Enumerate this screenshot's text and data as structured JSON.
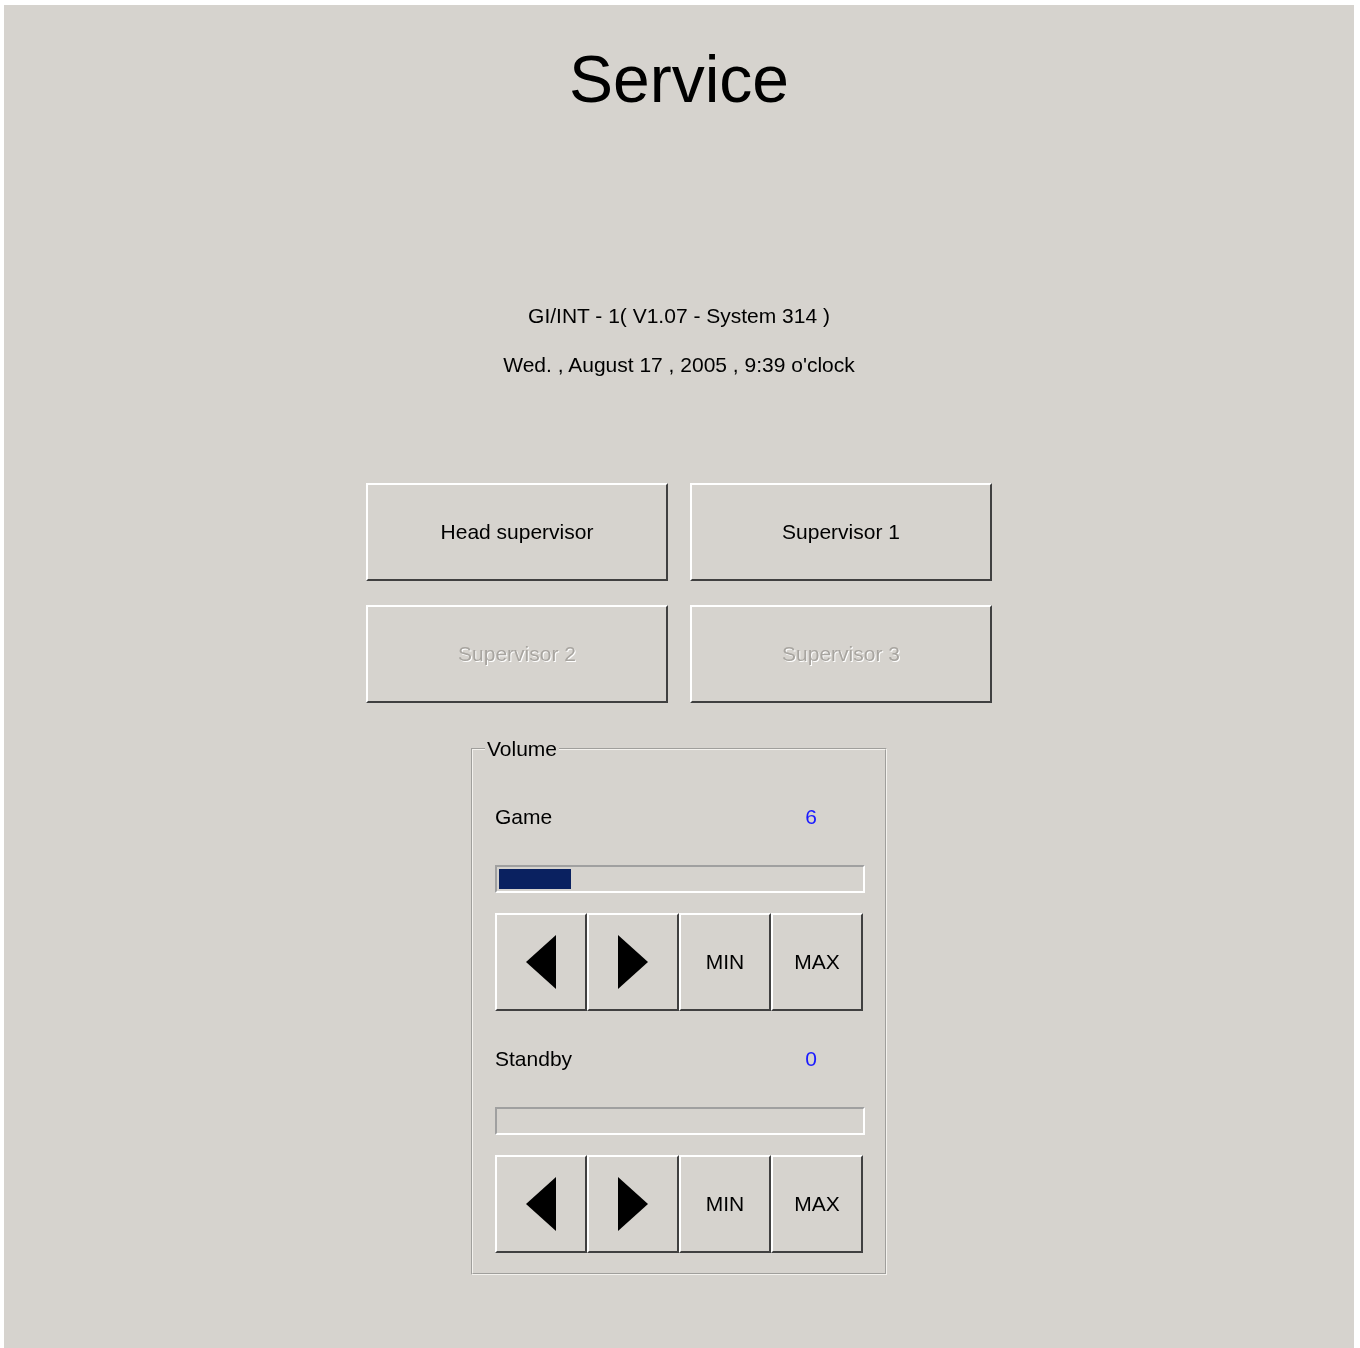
{
  "title": "Service",
  "info_lines": [
    "GI/INT - 1( V1.07 - System 314 )",
    "Wed. , August 17 , 2005 , 9:39 o'clock"
  ],
  "buttons": [
    {
      "label": "Head supervisor",
      "disabled": false
    },
    {
      "label": "Supervisor 1",
      "disabled": false
    },
    {
      "label": "Supervisor 2",
      "disabled": true
    },
    {
      "label": "Supervisor 3",
      "disabled": true
    }
  ],
  "volume": {
    "title": "Volume",
    "channels": [
      {
        "name": "Game",
        "value": "6",
        "level": 0.2,
        "min_label": "MIN",
        "max_label": "MAX"
      },
      {
        "name": "Standby",
        "value": "0",
        "min_label": "MIN",
        "max_label": "MAX"
      }
    ]
  }
}
